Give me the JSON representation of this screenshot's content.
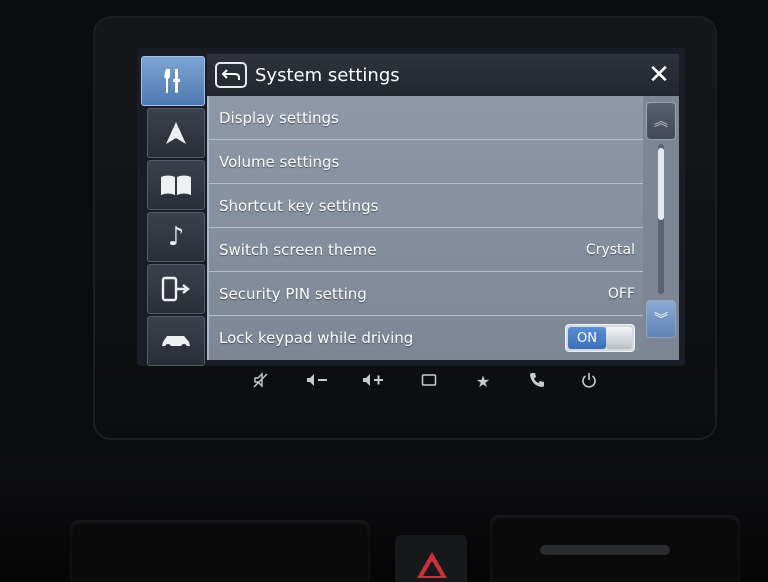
{
  "header": {
    "title": "System settings"
  },
  "tabs": [
    {
      "name": "settings",
      "icon": "tools-icon",
      "active": true
    },
    {
      "name": "navigation",
      "icon": "navigation-arrow-icon",
      "active": false
    },
    {
      "name": "map",
      "icon": "map-book-icon",
      "active": false
    },
    {
      "name": "music",
      "icon": "music-note-icon",
      "active": false
    },
    {
      "name": "phone",
      "icon": "phone-exit-icon",
      "active": false
    },
    {
      "name": "car",
      "icon": "car-icon",
      "active": false
    }
  ],
  "rows": [
    {
      "label": "Display settings",
      "value": ""
    },
    {
      "label": "Volume settings",
      "value": ""
    },
    {
      "label": "Shortcut key settings",
      "value": ""
    },
    {
      "label": "Switch screen theme",
      "value": "Crystal"
    },
    {
      "label": "Security PIN setting",
      "value": "OFF"
    },
    {
      "label": "Lock keypad while driving",
      "toggle": "ON"
    }
  ],
  "hardware_buttons": [
    "mute-icon",
    "volume-down-icon",
    "volume-up-icon",
    "screen-icon",
    "favorite-star-icon",
    "phone-icon",
    "power-icon"
  ],
  "colors": {
    "accent": "#4d78b0",
    "list_bg": "#8f98a6",
    "toggle_on": "#3b6fb8"
  }
}
